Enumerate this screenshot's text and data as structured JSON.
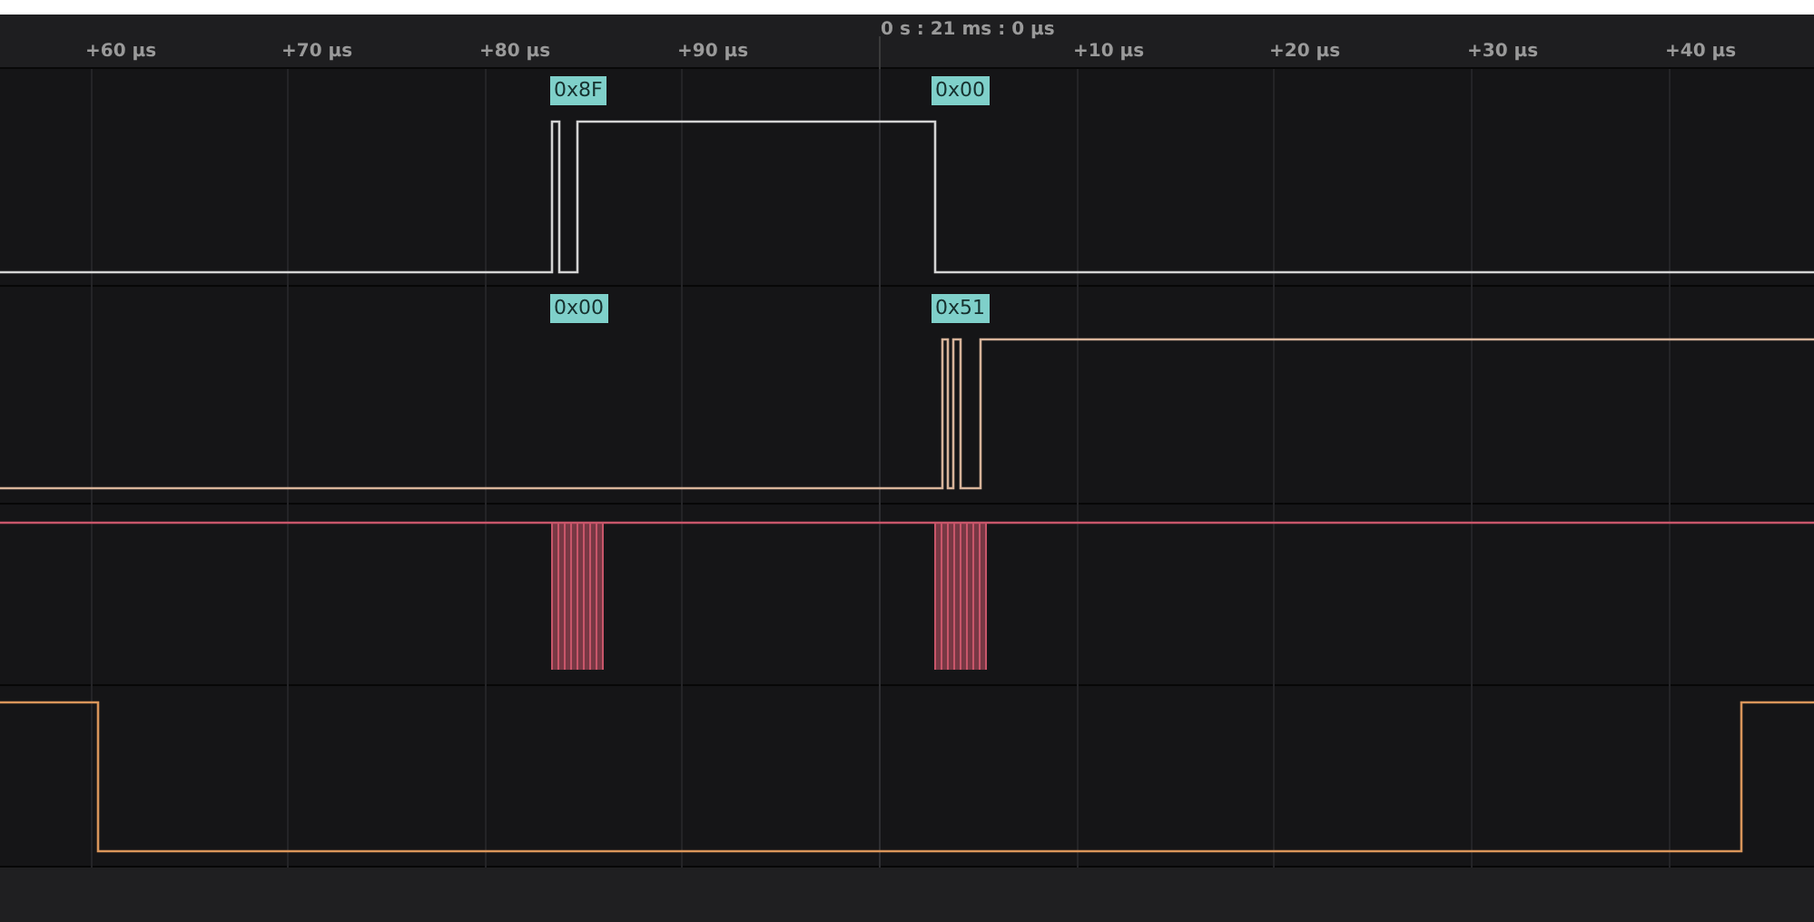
{
  "ruler": {
    "origin": "0 s : 21 ms : 0 µs",
    "ticks": [
      "+60 µs",
      "+70 µs",
      "+80 µs",
      "+90 µs",
      "+10 µs",
      "+20 µs",
      "+30 µs",
      "+40 µs"
    ]
  },
  "channels": [
    {
      "kind": "data",
      "color": "#d4d4d4",
      "annotations": [
        "0x8F",
        "0x00"
      ]
    },
    {
      "kind": "data",
      "color": "#d8b49a",
      "annotations": [
        "0x00",
        "0x51"
      ]
    },
    {
      "kind": "clock",
      "color": "#c8566a"
    },
    {
      "kind": "select",
      "color": "#d9955a"
    }
  ]
}
